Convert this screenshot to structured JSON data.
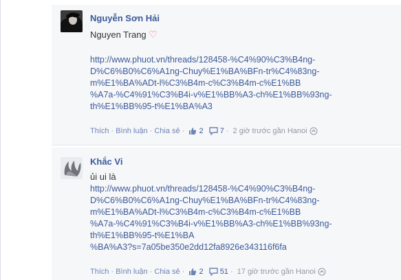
{
  "comments": [
    {
      "author": "Nguyễn Sơn Hải",
      "text": "Nguyen Trang",
      "emoji": "♡",
      "link_lines": [
        "http://www.phuot.vn/threads/128458-%C4%90%C3%B4ng-",
        "D%C6%B0%C6%A1ng-Chuy%E1%BA%BFn-tr%C4%83ng-",
        "m%E1%BA%ADt-l%C3%B4m-c%C3%B4m-c%E1%BB",
        "%A7a-%C4%91%C3%B4i-v%E1%BB%A3-ch%E1%BB%93ng-",
        "th%E1%BB%95-t%E1%BA%A3"
      ],
      "like_label": "Thích",
      "reply_label": "Bình luận",
      "share_label": "Chia sẻ",
      "like_count": "2",
      "comment_count": "7",
      "time": "2 giờ trước gần Hanoi"
    },
    {
      "author": "Khắc Vi",
      "text": "ủi ui là",
      "link_lines": [
        "http://www.phuot.vn/threads/128458-%C4%90%C3%B4ng-",
        "D%C6%B0%C6%A1ng-Chuy%E1%BA%BFn-tr%C4%83ng-",
        "m%E1%BA%ADt-l%C3%B4m-c%C3%B4m-c%E1%BB",
        "%A7a-%C4%91%C3%B4i-v%E1%BB%A3-ch%E1%BB%93ng-",
        "th%E1%BB%95-t%E1%BA",
        "%BA%A3?s=7a05be350e2dd12fa8926e343116f6fa"
      ],
      "like_label": "Thích",
      "reply_label": "Bình luận",
      "share_label": "Chia sẻ",
      "like_count": "2",
      "comment_count": "51",
      "time": "17 giờ trước gần Hanoi"
    }
  ],
  "colors": {
    "link": "#3b5998",
    "muted": "#9197a3",
    "background": "#f6f7f9"
  },
  "icons": [
    "thumbs-up-icon",
    "comment-bubble-icon",
    "share-arrow-icon"
  ]
}
